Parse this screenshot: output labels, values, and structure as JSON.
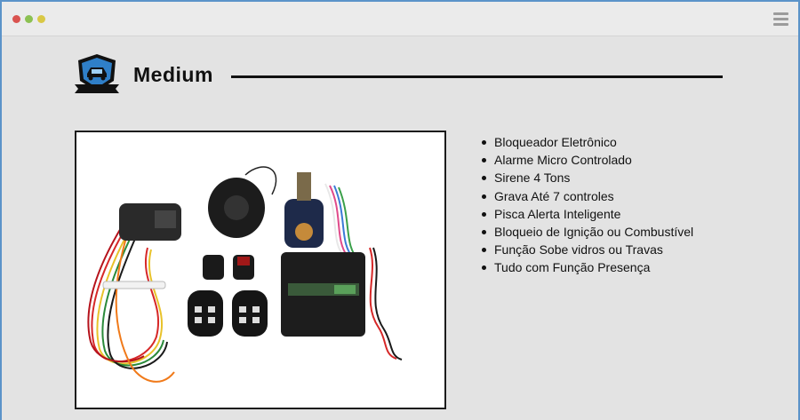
{
  "window": {
    "controls": [
      "close",
      "minimize",
      "maximize"
    ],
    "menu_icon": "hamburger-menu-icon"
  },
  "plan": {
    "title": "Medium",
    "badge_icon": "shield-car-icon",
    "image": "car-alarm-kit-photo"
  },
  "features": [
    "Bloqueador Eletrônico",
    "Alarme Micro Controlado",
    "Sirene 4 Tons",
    "Grava Até 7 controles",
    "Pisca Alerta Inteligente",
    "Bloqueio de Ignição ou Combustível",
    "Função Sobe vidros ou Travas",
    "Tudo com Função Presença"
  ],
  "colors": {
    "background": "#e3e3e3",
    "shield_blue": "#2f7fc8",
    "dark": "#111111"
  }
}
